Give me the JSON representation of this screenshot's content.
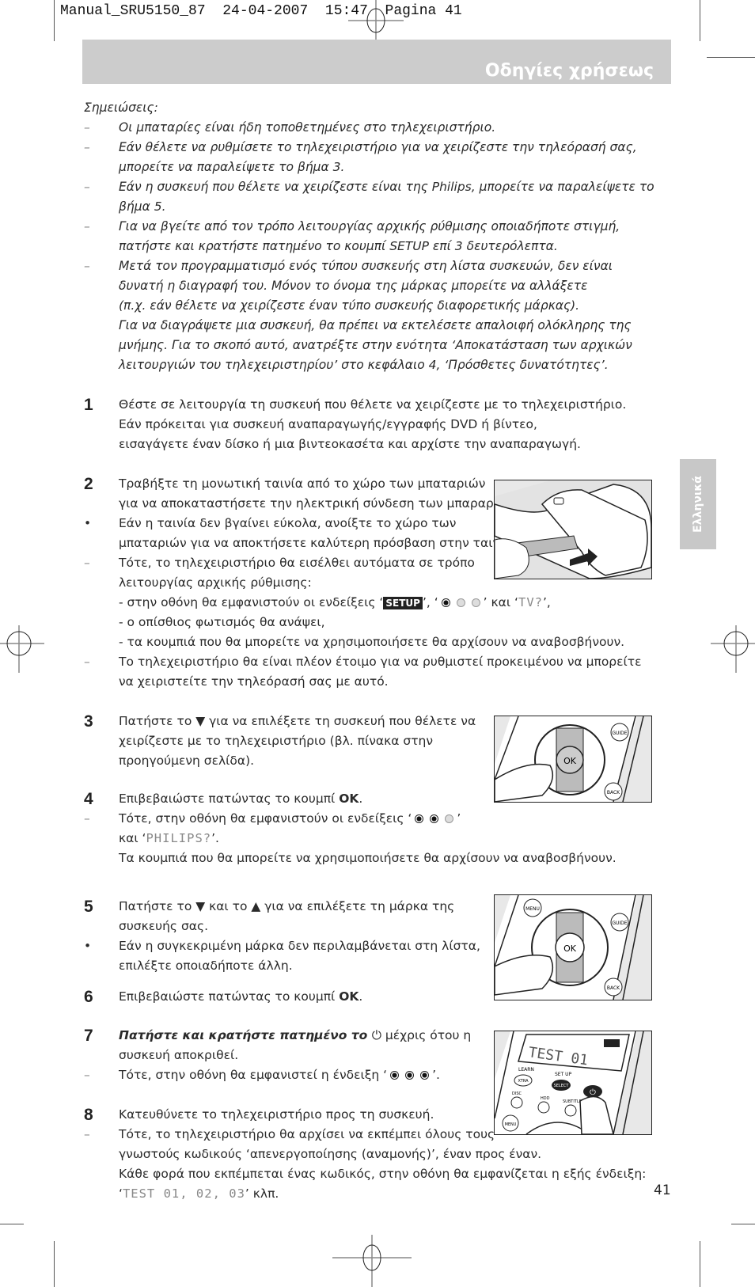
{
  "print_header": {
    "file": "Manual_SRU5150_87",
    "date": "24-04-2007",
    "time": "15:47",
    "page_label": "Pagina 41"
  },
  "banner_title": "Οδηγίες χρήσεως",
  "side_tab": "Ελληνικά",
  "notes": {
    "heading": "Σημειώσεις:",
    "items": [
      {
        "marker": "–",
        "lines": [
          "Οι μπαταρίες είναι ήδη τοποθετημένες στο τηλεχειριστήριο."
        ]
      },
      {
        "marker": "–",
        "lines": [
          "Εάν θέλετε να ρυθμίσετε το τηλεχειριστήριο για να χειρίζεστε την τηλεόρασή σας,",
          "μπορείτε να παραλείψετε το βήμα 3."
        ]
      },
      {
        "marker": "–",
        "lines": [
          "Εάν η συσκευή που θέλετε να χειρίζεστε είναι της Philips, μπορείτε να παραλείψετε το",
          "βήμα 5."
        ]
      },
      {
        "marker": "–",
        "lines": [
          "Για να βγείτε από τον τρόπο λειτουργίας αρχικής ρύθμισης οποιαδήποτε στιγμή,",
          "πατήστε και κρατήστε πατημένο το κουμπί SETUP επί 3 δευτερόλεπτα."
        ]
      },
      {
        "marker": "–",
        "lines": [
          "Μετά τον προγραμματισμό ενός τύπου συσκευής στη λίστα συσκευών, δεν είναι",
          "δυνατή η διαγραφή του. Μόνον το όνομα της μάρκας μπορείτε να αλλάξετε",
          "(π.χ. εάν θέλετε να χειρίζεστε έναν τύπο συσκευής διαφορετικής μάρκας).",
          "Για να διαγράψετε μια συσκευή, θα πρέπει να εκτελέσετε απαλοιφή ολόκληρης της",
          "μνήμης. Για το σκοπό αυτό, ανατρέξτε στην ενότητα ‘Αποκατάσταση των αρχικών",
          "λειτουργιών του τηλεχειριστηρίου’ στο κεφάλαιο 4, ‘Πρόσθετες δυνατότητες’."
        ]
      }
    ]
  },
  "steps": {
    "s1": {
      "num": "1",
      "lines": [
        "Θέστε σε λειτουργία τη συσκευή που θέλετε να χειρίζεστε με το τηλεχειριστήριο.",
        "Εάν πρόκειται για συσκευή αναπαραγωγής/εγγραφής DVD ή βίντεο,",
        "εισαγάγετε έναν δίσκο ή μια βιντεοκασέτα και αρχίστε την αναπαραγωγή."
      ]
    },
    "s2": {
      "num": "2",
      "lines": [
        "Τραβήξτε τη μονωτική ταινία από το χώρο των μπαταριών",
        "για να αποκαταστήσετε την ηλεκτρική σύνδεση των μπαραριών."
      ]
    },
    "s2_bullet": {
      "marker": "•",
      "lines": [
        "Εάν η ταινία δεν βγαίνει εύκολα, ανοίξτε το χώρο των",
        "μπαταριών για να αποκτήσετε καλύτερη πρόσβαση στην ταινία."
      ]
    },
    "s2_dash": {
      "marker": "–",
      "lines": [
        "Τότε, το τηλεχειριστήριο θα εισέλθει αυτόματα σε τρόπο",
        "λειτουργίας αρχικής ρύθμισης:"
      ]
    },
    "s2_sub": {
      "l1_pre": "- στην οθόνη θα εμφανιστούν οι ενδείξεις ‘",
      "setup_badge": "SETUP",
      "l1_mid": "’, ‘",
      "l1_post": "’ και ‘",
      "lcd_tv": "TV?",
      "l1_end": "’,",
      "l2": "- ο οπίσθιος φωτισμός θα ανάψει,",
      "l3": "- τα κουμπιά που θα μπορείτε να χρησιμοποιήσετε θα αρχίσουν να αναβοσβήνουν."
    },
    "s2_dash2": {
      "marker": "–",
      "lines": [
        "Το τηλεχειριστήριο θα είναι πλέον έτοιμο για να ρυθμιστεί προκειμένου να μπορείτε",
        "να χειριστείτε την τηλεόρασή σας με αυτό."
      ]
    },
    "s3": {
      "num": "3",
      "l1_pre": "Πατήστε το ",
      "down": "▼",
      "l1_post": " για να επιλέξετε τη συσκευή που θέλετε να",
      "l2": "χειρίζεστε με το τηλεχειριστήριο (βλ. πίνακα στην",
      "l3": "προηγούμενη σελίδα)."
    },
    "s4": {
      "num": "4",
      "l1_pre": "Επιβεβαιώστε πατώντας το κουμπί ",
      "ok": "OK",
      "l1_post": "."
    },
    "s4_dash": {
      "marker": "–",
      "l1_pre": "Τότε, στην οθόνη θα εμφανιστούν οι ενδείξεις ‘",
      "l1_post": "’",
      "l2_pre": "και ‘",
      "lcd": "PHILIPS?",
      "l2_post": "’.",
      "l3": "Τα κουμπιά που θα μπορείτε να χρησιμοποιήσετε θα αρχίσουν να αναβοσβήνουν."
    },
    "s5": {
      "num": "5",
      "l1_pre": "Πατήστε το ",
      "down": "▼",
      "l1_mid": " και το ",
      "up": "▲",
      "l1_post": " για να επιλέξετε τη μάρκα της",
      "l2": "συσκευής σας."
    },
    "s5_bullet": {
      "marker": "•",
      "lines": [
        "Εάν η συγκεκριμένη μάρκα δεν περιλαμβάνεται στη λίστα,",
        "επιλέξτε οποιαδήποτε άλλη."
      ]
    },
    "s6": {
      "num": "6",
      "l1_pre": "Επιβεβαιώστε πατώντας το κουμπί ",
      "ok": "OK",
      "l1_post": "."
    },
    "s7": {
      "num": "7",
      "l1_it": "Πατήστε και κρατήστε πατημένο το ",
      "power": "⏻",
      "l1_post": " μέχρις ότου η",
      "l2": "συσκευή αποκριθεί."
    },
    "s7_dash": {
      "marker": "–",
      "l1_pre": "Τότε, στην οθόνη θα εμφανιστεί η ένδειξη ‘",
      "l1_post": "’."
    },
    "s8": {
      "num": "8",
      "l1": "Κατευθύνετε το τηλεχειριστήριο προς τη συσκευή."
    },
    "s8_dash": {
      "marker": "–",
      "lines": [
        "Τότε, το τηλεχειριστήριο θα αρχίσει να εκπέμπει όλους τους",
        "γνωστούς κωδικούς ‘απενεργοποίησης (αναμονής)’, έναν προς έναν.",
        "Κάθε φορά που εκπέμπεται ένας κωδικός, στην οθόνη θα εμφανίζεται η εξής ένδειξη:"
      ],
      "l4_pre": "‘",
      "lcd": "TEST 01,  02, 03",
      "l4_post": "’ κλπ."
    }
  },
  "indicators": {
    "step2": [
      "on",
      "off",
      "off"
    ],
    "step4": [
      "on",
      "on",
      "off"
    ],
    "step7": [
      "on",
      "on",
      "on"
    ]
  },
  "figures": {
    "battery_strip": {
      "label": "battery-strip-removal"
    },
    "down_press": {
      "labels": [
        "GUIDE",
        "OK",
        "BACK"
      ]
    },
    "up_down_press": {
      "labels": [
        "MENU",
        "GUIDE",
        "OK",
        "BACK"
      ]
    },
    "power_press": {
      "lcd": "TEST 01",
      "labels": [
        "LEARN",
        "XTRA",
        "SET UP",
        "SELECT",
        "DISC",
        "HDD",
        "SUBTITLE",
        "MENU"
      ]
    }
  },
  "page_number": "41"
}
